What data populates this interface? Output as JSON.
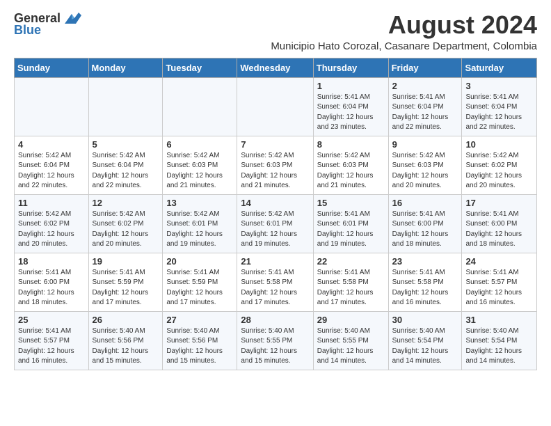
{
  "logo": {
    "general": "General",
    "blue": "Blue"
  },
  "header": {
    "title": "August 2024",
    "subtitle": "Municipio Hato Corozal, Casanare Department, Colombia"
  },
  "weekdays": [
    "Sunday",
    "Monday",
    "Tuesday",
    "Wednesday",
    "Thursday",
    "Friday",
    "Saturday"
  ],
  "weeks": [
    [
      {
        "day": "",
        "info": ""
      },
      {
        "day": "",
        "info": ""
      },
      {
        "day": "",
        "info": ""
      },
      {
        "day": "",
        "info": ""
      },
      {
        "day": "1",
        "info": "Sunrise: 5:41 AM\nSunset: 6:04 PM\nDaylight: 12 hours\nand 23 minutes."
      },
      {
        "day": "2",
        "info": "Sunrise: 5:41 AM\nSunset: 6:04 PM\nDaylight: 12 hours\nand 22 minutes."
      },
      {
        "day": "3",
        "info": "Sunrise: 5:41 AM\nSunset: 6:04 PM\nDaylight: 12 hours\nand 22 minutes."
      }
    ],
    [
      {
        "day": "4",
        "info": "Sunrise: 5:42 AM\nSunset: 6:04 PM\nDaylight: 12 hours\nand 22 minutes."
      },
      {
        "day": "5",
        "info": "Sunrise: 5:42 AM\nSunset: 6:04 PM\nDaylight: 12 hours\nand 22 minutes."
      },
      {
        "day": "6",
        "info": "Sunrise: 5:42 AM\nSunset: 6:03 PM\nDaylight: 12 hours\nand 21 minutes."
      },
      {
        "day": "7",
        "info": "Sunrise: 5:42 AM\nSunset: 6:03 PM\nDaylight: 12 hours\nand 21 minutes."
      },
      {
        "day": "8",
        "info": "Sunrise: 5:42 AM\nSunset: 6:03 PM\nDaylight: 12 hours\nand 21 minutes."
      },
      {
        "day": "9",
        "info": "Sunrise: 5:42 AM\nSunset: 6:03 PM\nDaylight: 12 hours\nand 20 minutes."
      },
      {
        "day": "10",
        "info": "Sunrise: 5:42 AM\nSunset: 6:02 PM\nDaylight: 12 hours\nand 20 minutes."
      }
    ],
    [
      {
        "day": "11",
        "info": "Sunrise: 5:42 AM\nSunset: 6:02 PM\nDaylight: 12 hours\nand 20 minutes."
      },
      {
        "day": "12",
        "info": "Sunrise: 5:42 AM\nSunset: 6:02 PM\nDaylight: 12 hours\nand 20 minutes."
      },
      {
        "day": "13",
        "info": "Sunrise: 5:42 AM\nSunset: 6:01 PM\nDaylight: 12 hours\nand 19 minutes."
      },
      {
        "day": "14",
        "info": "Sunrise: 5:42 AM\nSunset: 6:01 PM\nDaylight: 12 hours\nand 19 minutes."
      },
      {
        "day": "15",
        "info": "Sunrise: 5:41 AM\nSunset: 6:01 PM\nDaylight: 12 hours\nand 19 minutes."
      },
      {
        "day": "16",
        "info": "Sunrise: 5:41 AM\nSunset: 6:00 PM\nDaylight: 12 hours\nand 18 minutes."
      },
      {
        "day": "17",
        "info": "Sunrise: 5:41 AM\nSunset: 6:00 PM\nDaylight: 12 hours\nand 18 minutes."
      }
    ],
    [
      {
        "day": "18",
        "info": "Sunrise: 5:41 AM\nSunset: 6:00 PM\nDaylight: 12 hours\nand 18 minutes."
      },
      {
        "day": "19",
        "info": "Sunrise: 5:41 AM\nSunset: 5:59 PM\nDaylight: 12 hours\nand 17 minutes."
      },
      {
        "day": "20",
        "info": "Sunrise: 5:41 AM\nSunset: 5:59 PM\nDaylight: 12 hours\nand 17 minutes."
      },
      {
        "day": "21",
        "info": "Sunrise: 5:41 AM\nSunset: 5:58 PM\nDaylight: 12 hours\nand 17 minutes."
      },
      {
        "day": "22",
        "info": "Sunrise: 5:41 AM\nSunset: 5:58 PM\nDaylight: 12 hours\nand 17 minutes."
      },
      {
        "day": "23",
        "info": "Sunrise: 5:41 AM\nSunset: 5:58 PM\nDaylight: 12 hours\nand 16 minutes."
      },
      {
        "day": "24",
        "info": "Sunrise: 5:41 AM\nSunset: 5:57 PM\nDaylight: 12 hours\nand 16 minutes."
      }
    ],
    [
      {
        "day": "25",
        "info": "Sunrise: 5:41 AM\nSunset: 5:57 PM\nDaylight: 12 hours\nand 16 minutes."
      },
      {
        "day": "26",
        "info": "Sunrise: 5:40 AM\nSunset: 5:56 PM\nDaylight: 12 hours\nand 15 minutes."
      },
      {
        "day": "27",
        "info": "Sunrise: 5:40 AM\nSunset: 5:56 PM\nDaylight: 12 hours\nand 15 minutes."
      },
      {
        "day": "28",
        "info": "Sunrise: 5:40 AM\nSunset: 5:55 PM\nDaylight: 12 hours\nand 15 minutes."
      },
      {
        "day": "29",
        "info": "Sunrise: 5:40 AM\nSunset: 5:55 PM\nDaylight: 12 hours\nand 14 minutes."
      },
      {
        "day": "30",
        "info": "Sunrise: 5:40 AM\nSunset: 5:54 PM\nDaylight: 12 hours\nand 14 minutes."
      },
      {
        "day": "31",
        "info": "Sunrise: 5:40 AM\nSunset: 5:54 PM\nDaylight: 12 hours\nand 14 minutes."
      }
    ]
  ]
}
